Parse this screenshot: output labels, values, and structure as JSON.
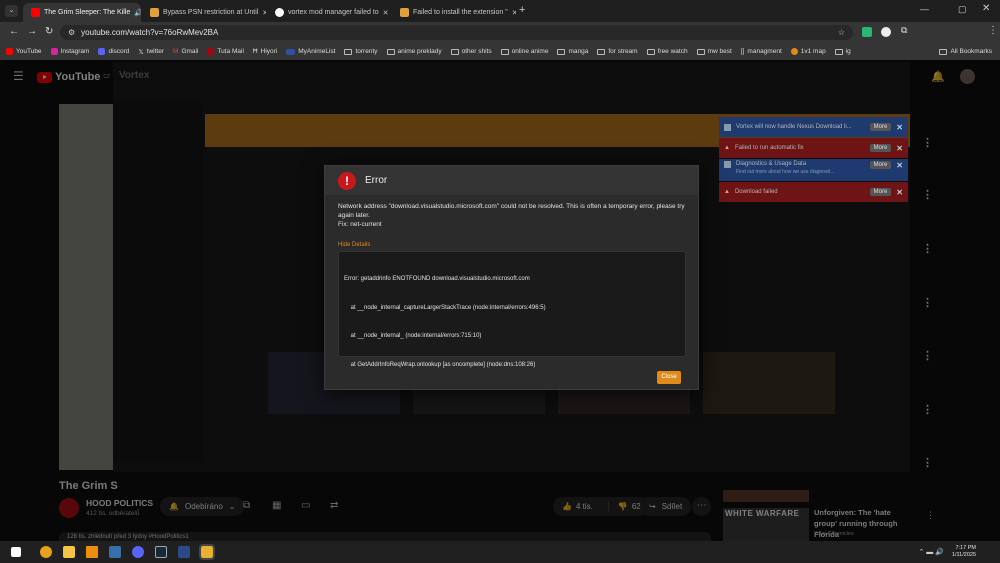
{
  "tabs": [
    {
      "title": "The Grim Sleeper: The Kille",
      "active": true
    },
    {
      "title": "Bypass PSN restriction at Until"
    },
    {
      "title": "vortex mod manager failed to"
    },
    {
      "title": "Failed to install the extension \""
    }
  ],
  "url": "youtube.com/watch?v=76oRwMev2BA",
  "bookmarks": [
    "YouTube",
    "Instagram",
    "discord",
    "twitter",
    "Gmail",
    "Tuta Mail",
    "Hiyori",
    "MyAnimeList",
    "torrenty",
    "anime preklady",
    "other shits",
    "online anime",
    "manga",
    "for stream",
    "free watch",
    "mw best",
    "managment",
    "1v1 map",
    "ig"
  ],
  "all_bookmarks": "All Bookmarks",
  "youtube": {
    "logo": "YouTube",
    "logo_sup": "CZ",
    "video_title": "The Grim S",
    "channel": "HOOD POLITICS",
    "subscribers": "412 tis. odběratelů",
    "subscribed_label": "Odebíráno",
    "likes": "4 tis.",
    "dislikes": "62",
    "share": "Sdílet",
    "views": "128 tis. zhlédnutí  před 3 týdny  #HoodPolitics1",
    "rec_title": "Unforgiven: The 'hate group' running through Florida",
    "rec_channel": "Killer Chronicles",
    "rec_thumb_text": "WHITE WARFARE"
  },
  "vortex": {
    "title": "Vortex",
    "notifications": [
      {
        "text": "Vortex will now handle Nexus Download li...",
        "more": "More"
      },
      {
        "text": "Failed to run automatic fix",
        "more": "More"
      },
      {
        "text": "Diagnostics & Usage Data",
        "sub": "Find out more about how we use diagnosti...",
        "more": "More"
      },
      {
        "text": "Download failed",
        "more": "More"
      }
    ]
  },
  "dialog": {
    "title": "Error",
    "message": "Network address \"download.visualstudio.microsoft.com\" could not be resolved. This is often a temporary error, please try again later.",
    "fix": "Fix: net-current",
    "hide_details": "Hide Details",
    "details": [
      "Error: getaddrinfo ENOTFOUND download.visualstudio.microsoft.com",
      "    at __node_internal_captureLargerStackTrace (node:internal/errors:496:5)",
      "    at __node_internal_ (node:internal/errors:715:10)",
      "    at GetAddrInfoReqWrap.onlookup [as oncomplete] (node:dns:108:26)"
    ],
    "close_label": "Close"
  },
  "taskbar": {
    "time": "7:17 PM",
    "date": "1/11/2025"
  },
  "colors": {
    "accent_orange": "#e08a18",
    "error_red": "#c8181e",
    "yt_red": "#ff0000"
  }
}
